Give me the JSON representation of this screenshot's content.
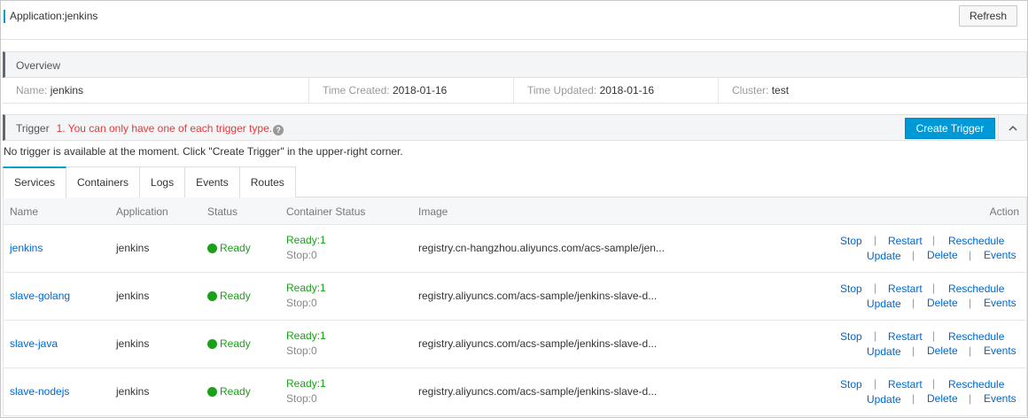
{
  "header": {
    "title": "Application:jenkins",
    "refresh_label": "Refresh"
  },
  "overview": {
    "heading": "Overview",
    "fields": [
      {
        "key": "Name:",
        "value": "jenkins"
      },
      {
        "key": "Time Created:",
        "value": "2018-01-16"
      },
      {
        "key": "Time Updated:",
        "value": "2018-01-16"
      },
      {
        "key": "Cluster:",
        "value": "test"
      }
    ]
  },
  "trigger": {
    "heading": "Trigger",
    "warning": "1. You can only have one of each trigger type.",
    "help_icon": "?",
    "create_label": "Create Trigger",
    "collapse_icon": "^",
    "empty_message": "No trigger is available at the moment. Click \"Create Trigger\" in the upper-right corner."
  },
  "tabs": [
    "Services",
    "Containers",
    "Logs",
    "Events",
    "Routes"
  ],
  "table": {
    "columns": [
      "Name",
      "Application",
      "Status",
      "Container Status",
      "Image",
      "Action"
    ],
    "rows": [
      {
        "name": "jenkins",
        "application": "jenkins",
        "status": "Ready",
        "cs_ready": "Ready:1",
        "cs_stop": "Stop:0",
        "image": "registry.cn-hangzhou.aliyuncs.com/acs-sample/jen..."
      },
      {
        "name": "slave-golang",
        "application": "jenkins",
        "status": "Ready",
        "cs_ready": "Ready:1",
        "cs_stop": "Stop:0",
        "image": "registry.aliyuncs.com/acs-sample/jenkins-slave-d..."
      },
      {
        "name": "slave-java",
        "application": "jenkins",
        "status": "Ready",
        "cs_ready": "Ready:1",
        "cs_stop": "Stop:0",
        "image": "registry.aliyuncs.com/acs-sample/jenkins-slave-d..."
      },
      {
        "name": "slave-nodejs",
        "application": "jenkins",
        "status": "Ready",
        "cs_ready": "Ready:1",
        "cs_stop": "Stop:0",
        "image": "registry.aliyuncs.com/acs-sample/jenkins-slave-d..."
      }
    ],
    "actions": {
      "stop": "Stop",
      "restart": "Restart",
      "reschedule": "Reschedule",
      "update": "Update",
      "delete": "Delete",
      "events": "Events",
      "separator": "|"
    }
  },
  "colors": {
    "accent": "#0099d8",
    "link": "#0066cc",
    "ready": "#1ca01a",
    "warning": "#e4393c"
  }
}
